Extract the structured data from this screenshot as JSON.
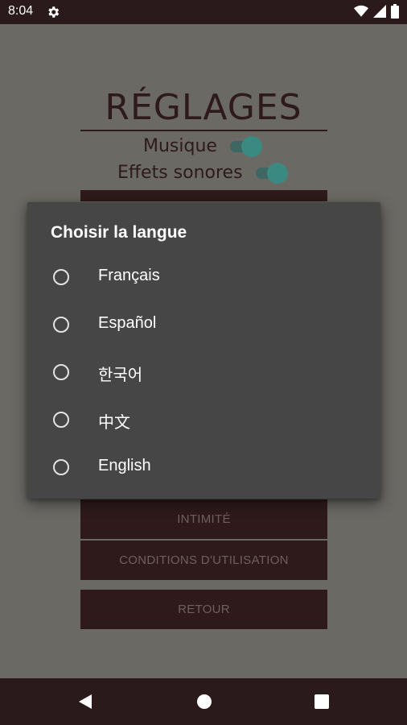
{
  "status_bar": {
    "time": "8:04",
    "icons": [
      "settings-icon",
      "wifi-icon",
      "signal-icon",
      "battery-icon"
    ]
  },
  "app": {
    "title": "RÉGLAGES",
    "settings": [
      {
        "label": "Musique",
        "enabled": true
      },
      {
        "label": "Effets sonores",
        "enabled": true
      }
    ],
    "buttons": {
      "privacy": "INTIMITÉ",
      "terms": "CONDITIONS D'UTILISATION",
      "back": "RETOUR"
    }
  },
  "dialog": {
    "title": "Choisir la langue",
    "options": [
      {
        "label": "Français",
        "selected": false
      },
      {
        "label": "Español",
        "selected": false
      },
      {
        "label": "한국어",
        "selected": false
      },
      {
        "label": "中文",
        "selected": false
      },
      {
        "label": "English",
        "selected": false
      }
    ]
  },
  "navigation": {
    "icons": [
      "back-icon",
      "home-icon",
      "recents-icon"
    ]
  },
  "colors": {
    "primary_dark": "#2e1a1b",
    "accent": "#3b8a81",
    "dialog_bg": "#464646"
  }
}
